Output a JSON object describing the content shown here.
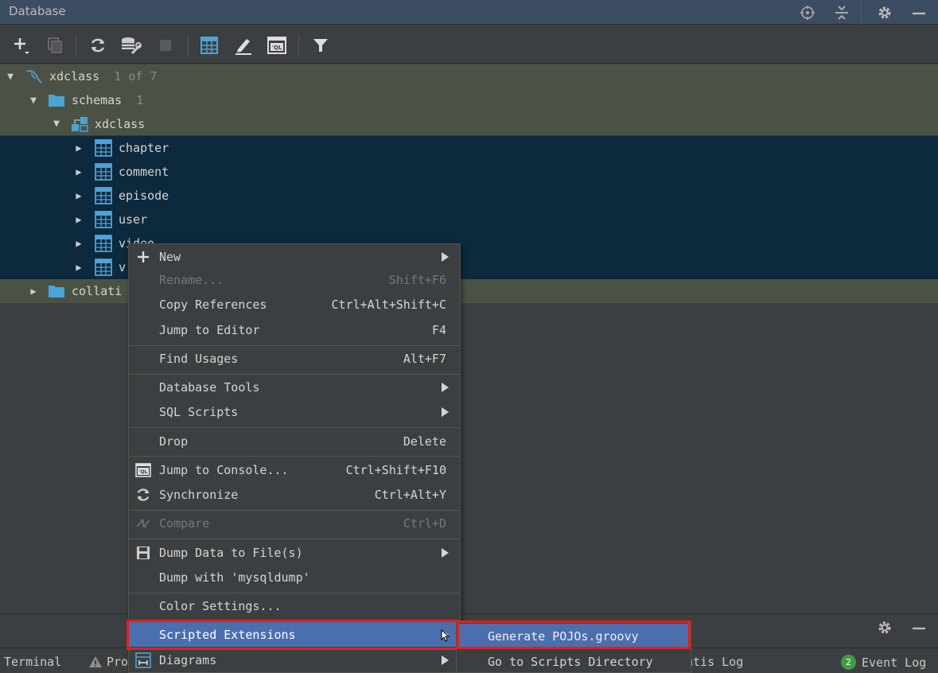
{
  "panel": {
    "title": "Database"
  },
  "tree": {
    "root": {
      "label": "xdclass",
      "count": "1 of 7"
    },
    "schemas": {
      "label": "schemas",
      "count": "1"
    },
    "schema": {
      "label": "xdclass"
    },
    "tables": [
      "chapter",
      "comment",
      "episode",
      "user",
      "video",
      "v"
    ],
    "collations": {
      "label": "collati"
    }
  },
  "menu": {
    "new": {
      "label": "New"
    },
    "rename": {
      "label": "Rename...",
      "shortcut": "Shift+F6"
    },
    "copy_refs": {
      "label": "Copy References",
      "shortcut": "Ctrl+Alt+Shift+C"
    },
    "jump_editor": {
      "label": "Jump to Editor",
      "shortcut": "F4"
    },
    "find_usages": {
      "label": "Find Usages",
      "shortcut": "Alt+F7"
    },
    "db_tools": {
      "label": "Database Tools"
    },
    "sql_scripts": {
      "label": "SQL Scripts"
    },
    "drop": {
      "label": "Drop",
      "shortcut": "Delete"
    },
    "jump_console": {
      "label": "Jump to Console...",
      "shortcut": "Ctrl+Shift+F10"
    },
    "synchronize": {
      "label": "Synchronize",
      "shortcut": "Ctrl+Alt+Y"
    },
    "compare": {
      "label": "Compare",
      "shortcut": "Ctrl+D"
    },
    "dump_data": {
      "label": "Dump Data to File(s)"
    },
    "dump_mysqldump": {
      "label": "Dump with 'mysqldump'"
    },
    "color_settings": {
      "label": "Color Settings..."
    },
    "scripted_ext": {
      "label": "Scripted Extensions"
    },
    "diagrams": {
      "label": "Diagrams"
    }
  },
  "submenu": {
    "generate_pojos": {
      "label": "Generate POJOs.groovy"
    },
    "scripts_dir": {
      "label": "Go to Scripts Directory"
    }
  },
  "statusbar": {
    "terminal": "Terminal",
    "problems": "Pro",
    "mybatis_log": "atis Log",
    "event_count": "2",
    "event_log": "Event Log"
  },
  "colors": {
    "accent": "#4b6eaf",
    "selection_blue": "#0d293e",
    "selection_grey": "#4b5245",
    "red_highlight": "#e0211b"
  }
}
